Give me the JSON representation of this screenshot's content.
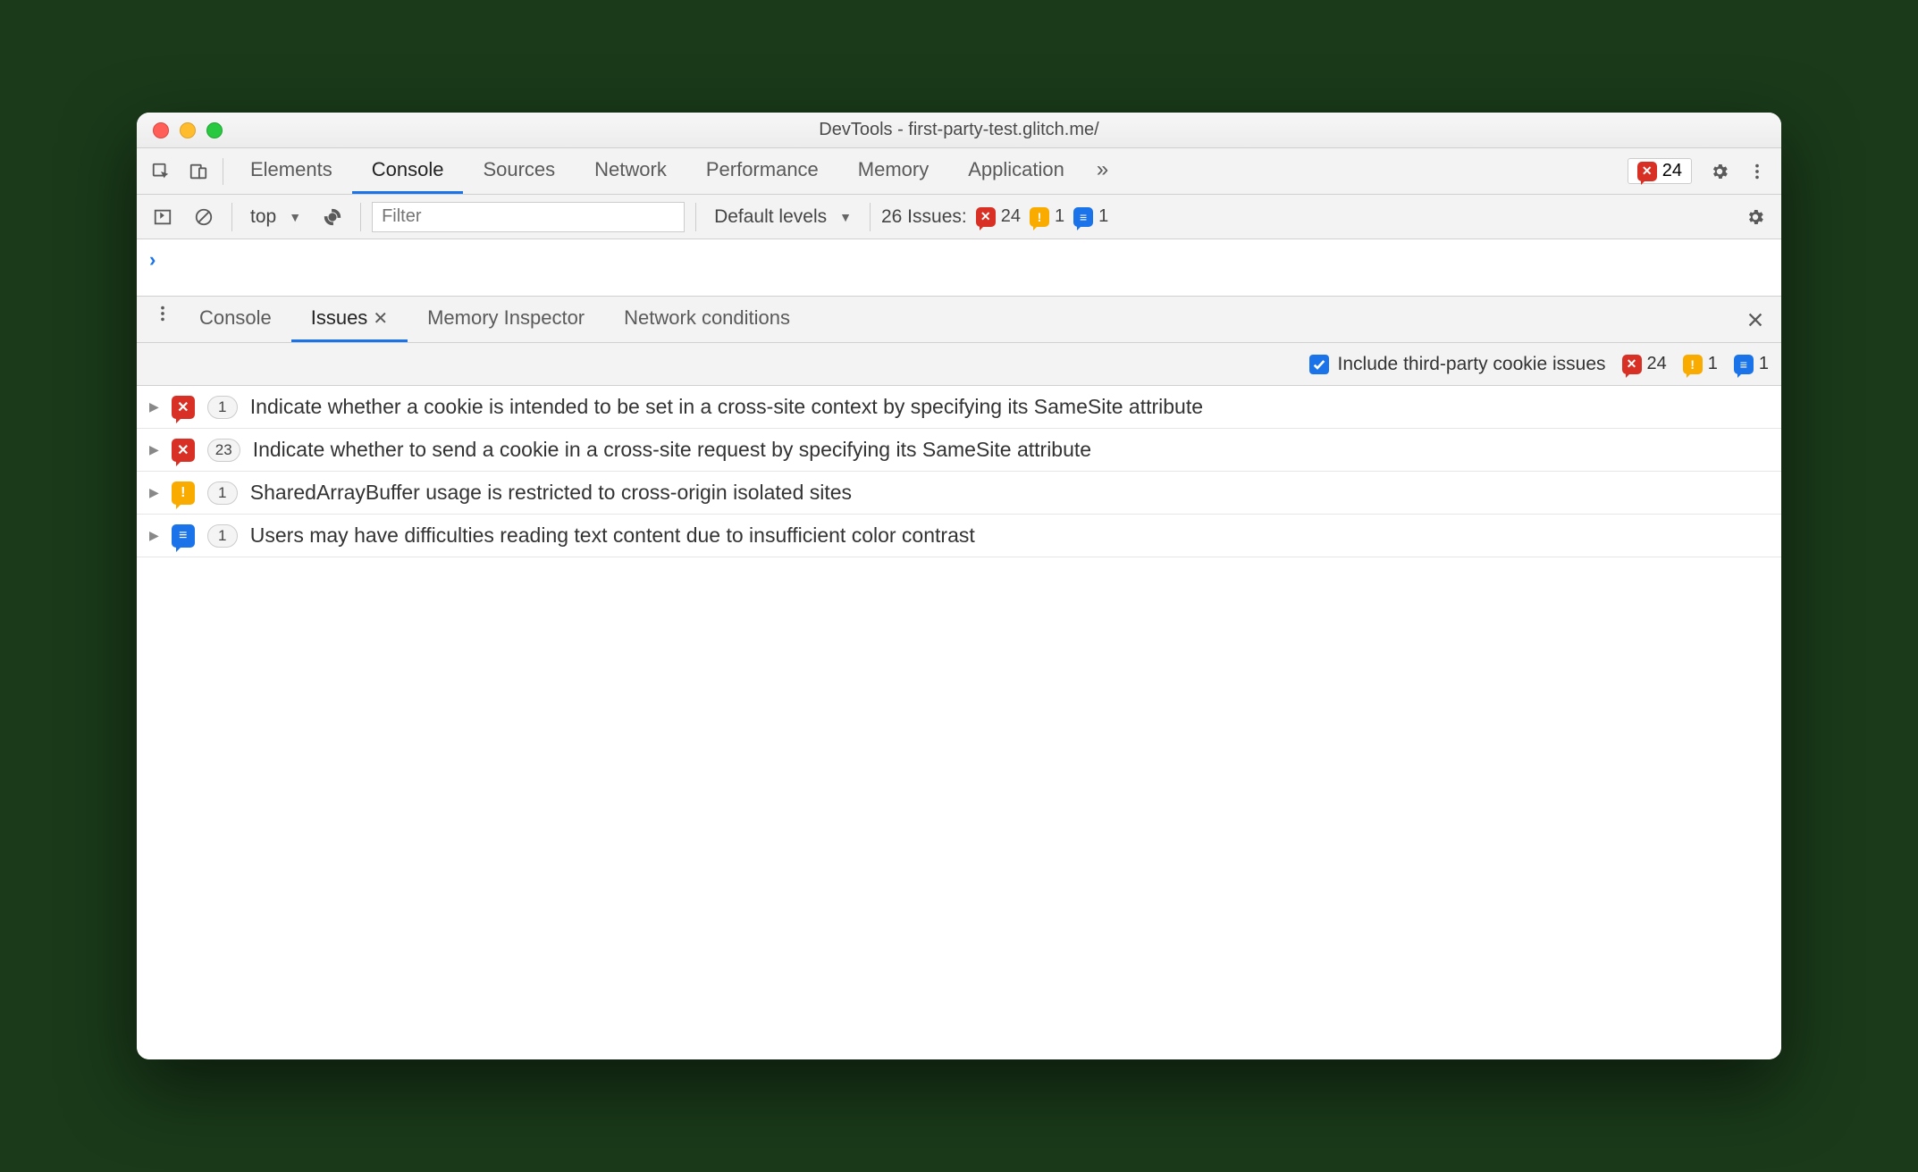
{
  "window": {
    "title": "DevTools - first-party-test.glitch.me/"
  },
  "main_tabs": {
    "items": [
      "Elements",
      "Console",
      "Sources",
      "Network",
      "Performance",
      "Memory",
      "Application"
    ],
    "active_index": 1,
    "overflow_glyph": "»",
    "error_badge_count": "24"
  },
  "console_toolbar": {
    "context": "top",
    "filter_placeholder": "Filter",
    "levels_label": "Default levels",
    "issues_label": "26 Issues:",
    "counts": {
      "error": "24",
      "warn": "1",
      "info": "1"
    }
  },
  "console_body": {
    "prompt": "›"
  },
  "drawer_tabs": {
    "items": [
      "Console",
      "Issues",
      "Memory Inspector",
      "Network conditions"
    ],
    "active_index": 1
  },
  "issues_toolbar": {
    "checkbox_checked": true,
    "checkbox_label": "Include third-party cookie issues",
    "counts": {
      "error": "24",
      "warn": "1",
      "info": "1"
    }
  },
  "issues": [
    {
      "severity": "error",
      "count": "1",
      "title": "Indicate whether a cookie is intended to be set in a cross-site context by specifying its SameSite attribute"
    },
    {
      "severity": "error",
      "count": "23",
      "title": "Indicate whether to send a cookie in a cross-site request by specifying its SameSite attribute"
    },
    {
      "severity": "warn",
      "count": "1",
      "title": "SharedArrayBuffer usage is restricted to cross-origin isolated sites"
    },
    {
      "severity": "info",
      "count": "1",
      "title": "Users may have difficulties reading text content due to insufficient color contrast"
    }
  ],
  "severity_glyph": {
    "error": "✕",
    "warn": "!",
    "info": "≡"
  }
}
